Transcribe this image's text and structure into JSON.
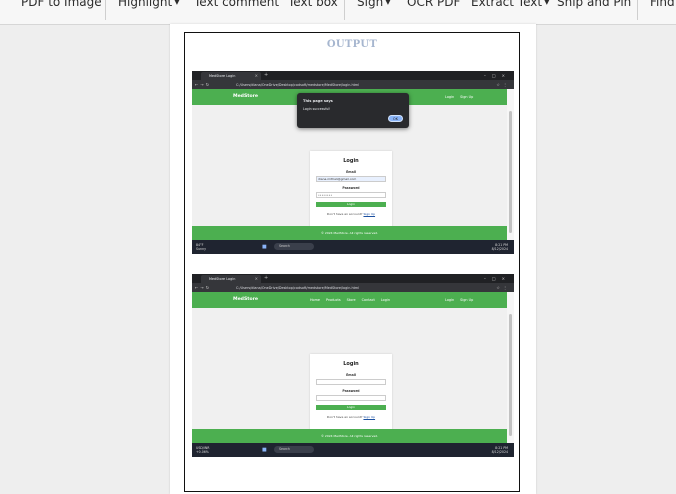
{
  "toolbar": {
    "pdf_to_image": "PDF to Image",
    "highlight": "Highlight",
    "text_comment": "Text comment",
    "text_box": "Text box",
    "sign": "Sign",
    "ocr_pdf": "OCR PDF",
    "extract_text": "Extract Text",
    "snip_and_pin": "Snip and Pin",
    "find": "Find"
  },
  "document": {
    "heading": "OUTPUT",
    "screenshots": [
      {
        "tab_title": "MedStore Login",
        "url": "C:/Users/diana/OneDrive/Desktop/codsoft/medstore/MedStore/login.html",
        "brand": "MedStore",
        "nav_links": [],
        "nav_auth": [
          "Login",
          "Sign Up"
        ],
        "login_title": "Login",
        "email_label": "Email",
        "email_value": "diana.mithali@gmail.com",
        "password_label": "Password",
        "password_value": "••••••••",
        "login_button": "Login",
        "signup_prompt": "Don't have an account?",
        "signup_link": "Sign Up",
        "footer": "© 2024 MedStore. All rights reserved.",
        "weather": [
          "84°F",
          "Sunny"
        ],
        "search": "Search",
        "time": "8:21 PM",
        "date": "8/12/2024",
        "dialog": {
          "title": "This page says",
          "message": "Login successful!",
          "ok": "OK"
        }
      },
      {
        "tab_title": "MedStore Login",
        "url": "C:/Users/diana/OneDrive/Desktop/codsoft/medstore/MedStore/login.html",
        "brand": "MedStore",
        "nav_links": [
          "Home",
          "Products",
          "Store",
          "Contact",
          "Login"
        ],
        "nav_auth": [
          "Login",
          "Sign Up"
        ],
        "login_title": "Login",
        "email_label": "Email",
        "email_value": "",
        "password_label": "Password",
        "password_value": "",
        "login_button": "Login",
        "signup_prompt": "Don't have an account?",
        "signup_link": "Sign Up",
        "footer": "© 2024 MedStore. All rights reserved.",
        "weather": [
          "USD/INR",
          "+0.06%"
        ],
        "search": "Search",
        "time": "8:21 PM",
        "date": "8/12/2024"
      }
    ]
  }
}
